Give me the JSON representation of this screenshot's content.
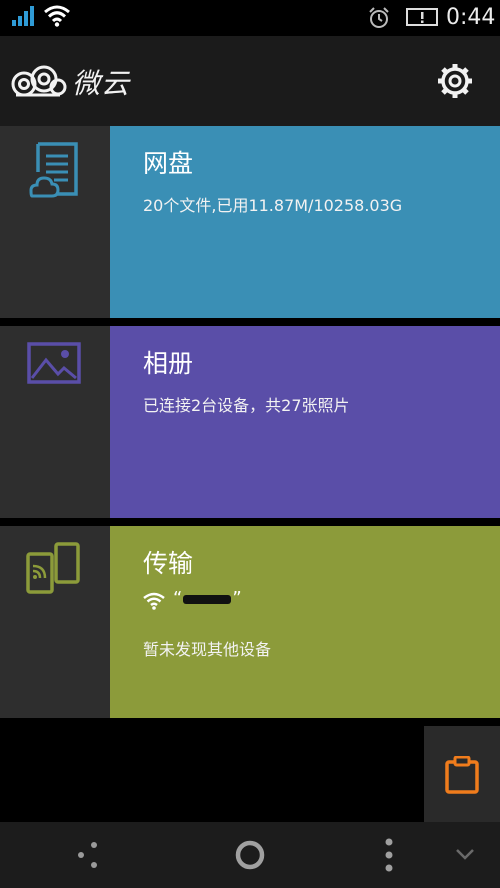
{
  "status_bar": {
    "time": "0:44",
    "icons": [
      "signal-icon",
      "wifi-icon",
      "alarm-icon",
      "notification-icon"
    ]
  },
  "header": {
    "logo_text": "微云",
    "icons": [
      "cloud-logo-icon",
      "settings-gear-icon"
    ]
  },
  "cards": [
    {
      "id": "netdisk",
      "title": "网盘",
      "subtitle": "20个文件,已用11.87M/10258.03G",
      "color": "#3a8fb5",
      "icon": "document-cloud-icon"
    },
    {
      "id": "album",
      "title": "相册",
      "subtitle": "已连接2台设备，共27张照片",
      "color": "#5a4ea8",
      "icon": "picture-icon"
    },
    {
      "id": "transfer",
      "title": "传输",
      "wifi_quote_open": "“",
      "wifi_quote_close": "”",
      "subtitle": "暂未发现其他设备",
      "color": "#8c9b3a",
      "icon": "devices-transfer-icon"
    }
  ],
  "clipboard": {
    "icon": "clipboard-icon",
    "color": "#f07c1c"
  },
  "nav_bar": {
    "icons": [
      "share-icon",
      "home-circle-icon",
      "menu-dots-icon",
      "chevron-down-icon"
    ]
  }
}
